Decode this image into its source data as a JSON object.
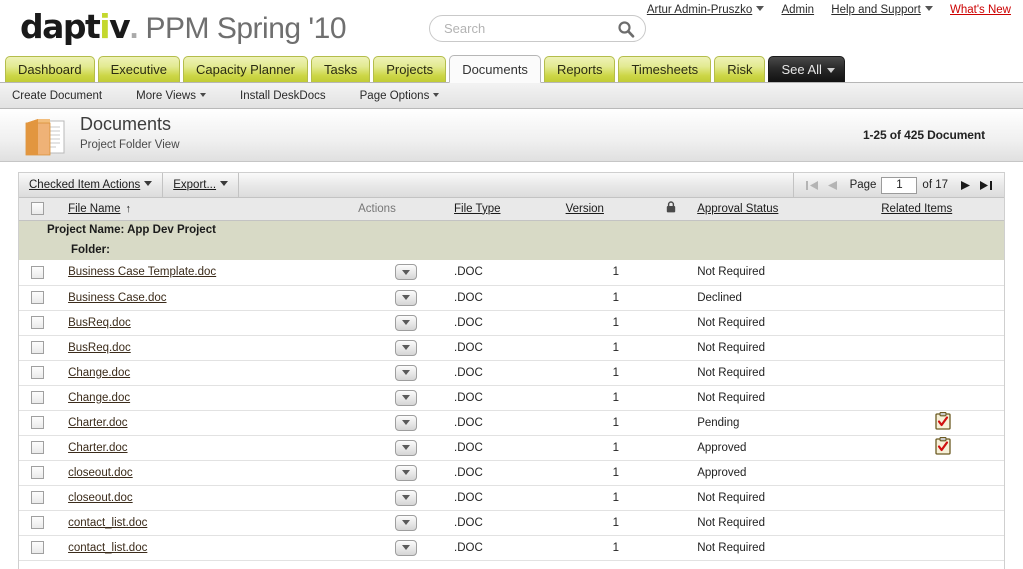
{
  "brand": {
    "name_part1": "dapt",
    "name_i": "i",
    "name_part2": "v",
    "name_dot": ".",
    "product": "PPM Spring '10"
  },
  "search": {
    "placeholder": "Search",
    "value": "",
    "icon": "search-icon"
  },
  "user_links": [
    {
      "label": "Artur Admin-Pruszko",
      "has_caret": true,
      "style": "normal"
    },
    {
      "label": "Admin",
      "has_caret": false,
      "style": "normal"
    },
    {
      "label": "Help and Support",
      "has_caret": true,
      "style": "normal"
    },
    {
      "label": "What's New",
      "has_caret": false,
      "style": "red"
    }
  ],
  "nav_tabs": [
    {
      "label": "Dashboard",
      "state": "normal"
    },
    {
      "label": "Executive",
      "state": "normal"
    },
    {
      "label": "Capacity Planner",
      "state": "normal"
    },
    {
      "label": "Tasks",
      "state": "normal"
    },
    {
      "label": "Projects",
      "state": "normal"
    },
    {
      "label": "Documents",
      "state": "active"
    },
    {
      "label": "Reports",
      "state": "normal"
    },
    {
      "label": "Timesheets",
      "state": "normal"
    },
    {
      "label": "Risk",
      "state": "normal"
    },
    {
      "label": "See All",
      "state": "dark"
    }
  ],
  "subnav": [
    {
      "label": "Create Document",
      "has_caret": false
    },
    {
      "label": "More Views",
      "has_caret": true
    },
    {
      "label": "Install DeskDocs",
      "has_caret": false
    },
    {
      "label": "Page Options",
      "has_caret": true
    }
  ],
  "page_header": {
    "icon": "folder-documents-icon",
    "title": "Documents",
    "subtitle": "Project Folder View",
    "record_count": "1-25 of 425 Document"
  },
  "grid_toolbar": {
    "checked_item_actions": "Checked Item Actions",
    "export": "Export...",
    "pager": {
      "first_icon": "first-page-icon",
      "prev_icon": "prev-page-icon",
      "page_label": "Page",
      "page_value": "1",
      "of_label": "of 17",
      "next_icon": "next-page-icon",
      "last_icon": "last-page-icon"
    }
  },
  "table": {
    "columns": [
      {
        "key": "checkbox",
        "label": "",
        "sortable": false
      },
      {
        "key": "name",
        "label": "File Name",
        "sortable": true,
        "sort": "asc"
      },
      {
        "key": "actions",
        "label": "Actions",
        "sortable": false
      },
      {
        "key": "ftype",
        "label": "File Type",
        "sortable": true
      },
      {
        "key": "version",
        "label": "Version",
        "sortable": true
      },
      {
        "key": "lock",
        "label": "lock-icon",
        "sortable": false
      },
      {
        "key": "approval",
        "label": "Approval Status",
        "sortable": true
      },
      {
        "key": "related",
        "label": "Related Items",
        "sortable": true
      }
    ],
    "sort_asc_glyph": "↑",
    "groups": [
      {
        "level": 1,
        "label": "Project Name: App Dev Project"
      },
      {
        "level": 2,
        "label": "Folder:"
      }
    ],
    "rows": [
      {
        "name": "Business Case Template.doc",
        "ftype": ".DOC",
        "version": "1",
        "approval": "Not Required",
        "related_icon": ""
      },
      {
        "name": "Business Case.doc",
        "ftype": ".DOC",
        "version": "1",
        "approval": "Declined",
        "related_icon": ""
      },
      {
        "name": "BusReq.doc",
        "ftype": ".DOC",
        "version": "1",
        "approval": "Not Required",
        "related_icon": ""
      },
      {
        "name": "BusReq.doc",
        "ftype": ".DOC",
        "version": "1",
        "approval": "Not Required",
        "related_icon": ""
      },
      {
        "name": "Change.doc",
        "ftype": ".DOC",
        "version": "1",
        "approval": "Not Required",
        "related_icon": ""
      },
      {
        "name": "Change.doc",
        "ftype": ".DOC",
        "version": "1",
        "approval": "Not Required",
        "related_icon": ""
      },
      {
        "name": "Charter.doc",
        "ftype": ".DOC",
        "version": "1",
        "approval": "Pending",
        "related_icon": "approval-clipboard-icon"
      },
      {
        "name": "Charter.doc",
        "ftype": ".DOC",
        "version": "1",
        "approval": "Approved",
        "related_icon": "approval-clipboard-icon"
      },
      {
        "name": "closeout.doc",
        "ftype": ".DOC",
        "version": "1",
        "approval": "Approved",
        "related_icon": ""
      },
      {
        "name": "closeout.doc",
        "ftype": ".DOC",
        "version": "1",
        "approval": "Not Required",
        "related_icon": ""
      },
      {
        "name": "contact_list.doc",
        "ftype": ".DOC",
        "version": "1",
        "approval": "Not Required",
        "related_icon": ""
      },
      {
        "name": "contact_list.doc",
        "ftype": ".DOC",
        "version": "1",
        "approval": "Not Required",
        "related_icon": ""
      }
    ]
  },
  "colors": {
    "tab_green_light": "#eef2b7",
    "tab_green_dark": "#c1cc35",
    "brand_accent": "#c4d82e",
    "group_row_bg": "#d8dac6",
    "whats_new_red": "#cc0000",
    "link_brown": "#3b2b1a"
  }
}
